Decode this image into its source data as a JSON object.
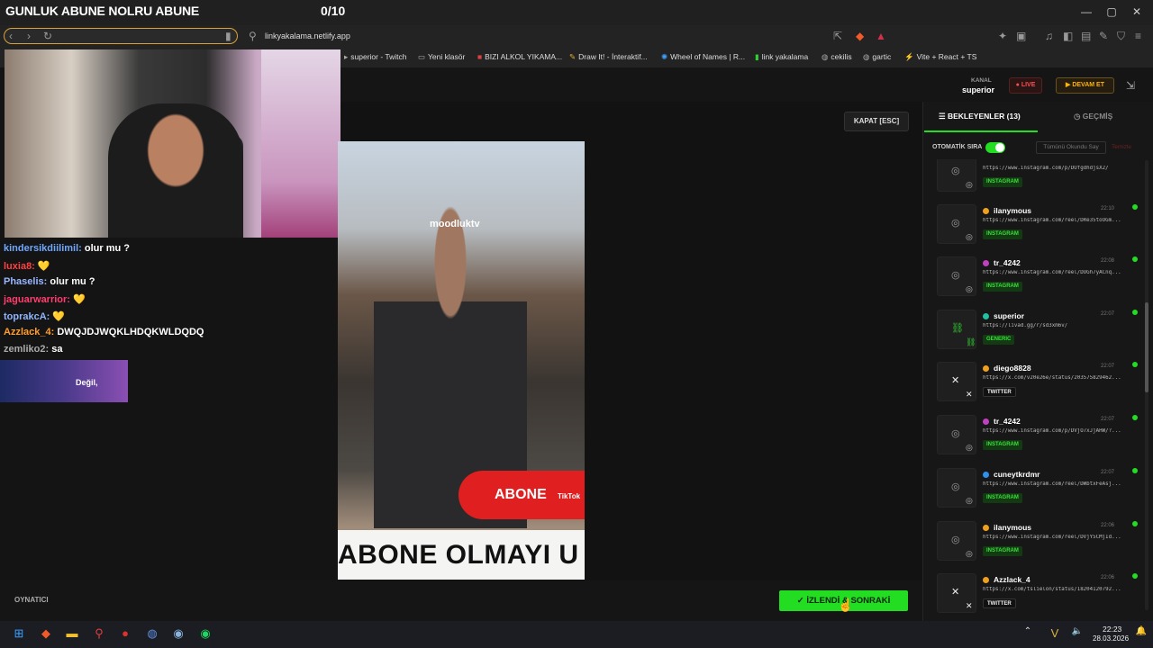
{
  "overlay": {
    "title": "GUNLUK ABUNE NOLRU ABUNE",
    "counter": "0/10"
  },
  "browser": {
    "url": "linkyakalama.netlify.app",
    "bookmarks": [
      {
        "label": "superior - Twitch",
        "icon": "twitch-icon"
      },
      {
        "label": "Yeni klasör",
        "icon": "folder-icon"
      },
      {
        "label": "BIZI ALKOL YIKAMA...",
        "icon": "page-icon"
      },
      {
        "label": "Draw It! - İnteraktif...",
        "icon": "draw-icon"
      },
      {
        "label": "Wheel of Names | R...",
        "icon": "wheel-icon"
      },
      {
        "label": "link yakalama",
        "icon": "link-icon"
      },
      {
        "label": "cekilis",
        "icon": "globe-icon"
      },
      {
        "label": "gartic",
        "icon": "globe-icon"
      },
      {
        "label": "Vite + React + TS",
        "icon": "vite-icon"
      }
    ]
  },
  "chat": {
    "lines": [
      {
        "user": "kindersikdiilimil:",
        "msg": "olur mu ?",
        "color": "#6fa8ff"
      },
      {
        "user": "luxia8:",
        "msg": "💛",
        "color": "#ff4040"
      },
      {
        "user": "Phaselis:",
        "msg": "olur mu ?",
        "color": "#9ab6ff"
      },
      {
        "user": "jaguarwarrior:",
        "msg": "💛",
        "color": "#ff3d6e"
      },
      {
        "user": "toprakcA:",
        "msg": "💛",
        "color": "#8fb5ff"
      },
      {
        "user": "Azzlack_4:",
        "msg": "DWQJDJWQKLHDQKWLDQDQ",
        "color": "#ff9d2e"
      },
      {
        "user": "zemliko2:",
        "msg": "sa",
        "color": "#aaa"
      }
    ],
    "banner_text": "Değil,"
  },
  "header": {
    "kanal_label": "KANAL",
    "kanal_name": "superior",
    "live": "LIVE",
    "devam": "DEVAM ET"
  },
  "player": {
    "close_label": "KAPAT [ESC]",
    "video_watermark": "moodluktv",
    "video_caption": "ABONE OLMAYI U",
    "video_abone": "ABONE",
    "video_tiktok": "TikTok",
    "footer_label": "OYNATICI",
    "next_label": "İZLENDİ & SONRAKİ"
  },
  "sidebar": {
    "tab_waiting": "BEKLEYENLER (13)",
    "tab_history": "GEÇMİŞ",
    "auto_label": "OTOMATİK SIRA",
    "auto_on": true,
    "mark_all": "Tümünü Okundu Say",
    "clear": "Temizle",
    "queue": [
      {
        "user": "",
        "time": "",
        "url": "https://www.instagram.com/p/DUfgdhdjsX2/",
        "badge": "INSTAGRAM",
        "type": "instagram",
        "avatar": ""
      },
      {
        "user": "ilanymous",
        "time": "22:10",
        "url": "https://www.instagram.com/reel/DRe35toOGm...",
        "badge": "INSTAGRAM",
        "type": "instagram",
        "avatar": "#f0a020"
      },
      {
        "user": "tr_4242",
        "time": "22:08",
        "url": "https://www.instagram.com/reel/DUGh7yACnq...",
        "badge": "INSTAGRAM",
        "type": "instagram",
        "avatar": "#c040c0"
      },
      {
        "user": "superior",
        "time": "22:07",
        "url": "https://livad.gg/r/sd3xm6v/",
        "badge": "GENERIC",
        "type": "generic",
        "avatar": "#20c0a0"
      },
      {
        "user": "diego8828",
        "time": "22:07",
        "url": "https://x.com/v20e26e/status/203575829462...",
        "badge": "TWITTER",
        "type": "twitter",
        "avatar": "#f0a020"
      },
      {
        "user": "tr_4242",
        "time": "22:07",
        "url": "https://www.instagram.com/p/DVjO7xJjAHW/?...",
        "badge": "INSTAGRAM",
        "type": "instagram",
        "avatar": "#c040c0"
      },
      {
        "user": "cuneytkrdmr",
        "time": "22:07",
        "url": "https://www.instagram.com/reel/DWbtxFeAsj...",
        "badge": "INSTAGRAM",
        "type": "instagram",
        "avatar": "#3090f0"
      },
      {
        "user": "ilanymous",
        "time": "22:06",
        "url": "https://www.instagram.com/reel/DVjY5CMjId...",
        "badge": "INSTAGRAM",
        "type": "instagram",
        "avatar": "#f0a020"
      },
      {
        "user": "Azzlack_4",
        "time": "22:06",
        "url": "https://x.com/tslielon/status/18204120792...",
        "badge": "TWITTER",
        "type": "twitter",
        "avatar": "#f0a020"
      }
    ]
  },
  "taskbar": {
    "time": "22:23",
    "date": "28.03.2026"
  }
}
